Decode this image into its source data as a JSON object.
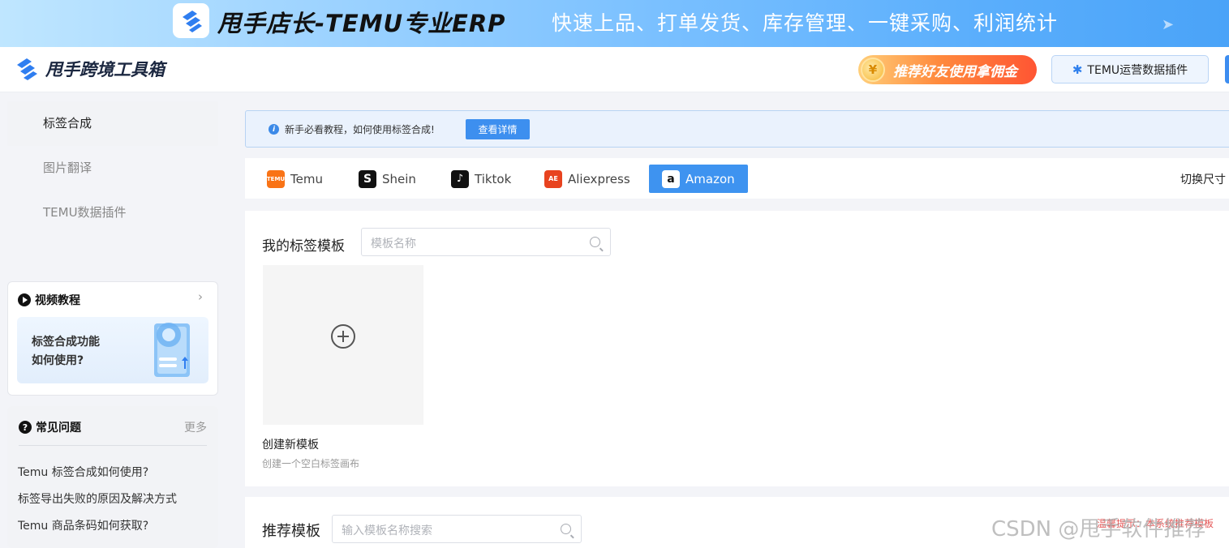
{
  "banner": {
    "brand": "甩手店长-TEMU专业ERP",
    "slogan": "快速上品、打单发货、库存管理、一键采购、利润统计"
  },
  "header": {
    "title": "甩手跨境工具箱",
    "promo": "推荐好友使用拿佣金",
    "plugin_button": "TEMU运营数据插件"
  },
  "sidebar": {
    "items": [
      {
        "label": "标签合成",
        "active": true
      },
      {
        "label": "图片翻译",
        "active": false
      },
      {
        "label": "TEMU数据插件",
        "active": false
      }
    ]
  },
  "video_card": {
    "title": "视频教程",
    "line1": "标签合成功能",
    "line2": "如何使用?"
  },
  "faq": {
    "title": "常见问题",
    "more": "更多",
    "items": [
      "Temu 标签合成如何使用?",
      "标签导出失败的原因及解决方式",
      "Temu 商品条码如何获取?"
    ]
  },
  "notice": {
    "text": "新手必看教程，如何使用标签合成!",
    "button": "查看详情"
  },
  "platform_tabs": [
    {
      "label": "Temu",
      "icon": "temu-icon",
      "color": "#f97316",
      "active": false
    },
    {
      "label": "Shein",
      "icon": "shein-icon",
      "color": "#111111",
      "active": false
    },
    {
      "label": "Tiktok",
      "icon": "tiktok-icon",
      "color": "#111111",
      "active": false
    },
    {
      "label": "Aliexpress",
      "icon": "aliexpress-icon",
      "color": "#e8431f",
      "active": false
    },
    {
      "label": "Amazon",
      "icon": "amazon-icon",
      "color": "#ffffff",
      "active": true
    }
  ],
  "switch_size": "切换尺寸",
  "my_templates": {
    "title": "我的标签模板",
    "search_placeholder": "模板名称",
    "create_title": "创建新模板",
    "create_subtitle": "创建一个空白标签画布"
  },
  "recommended": {
    "title": "推荐模板",
    "search_placeholder": "输入模板名称搜索",
    "hint": "温馨提示：本系统推荐模板"
  },
  "watermark": "CSDN @甩手软件推荐",
  "colors": {
    "accent": "#3e93f0",
    "promo": "#ff6a33"
  }
}
